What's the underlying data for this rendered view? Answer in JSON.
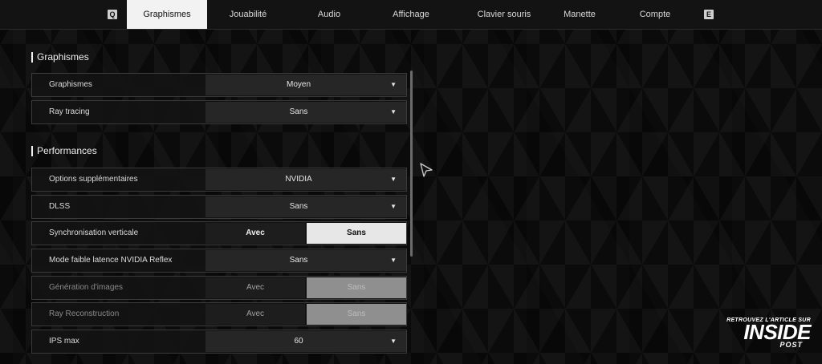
{
  "tabs": {
    "prev_key": "Q",
    "next_key": "E",
    "items": [
      {
        "label": "Graphismes",
        "active": true
      },
      {
        "label": "Jouabilité"
      },
      {
        "label": "Audio"
      },
      {
        "label": "Affichage"
      },
      {
        "label": "Clavier souris"
      },
      {
        "label": "Manette"
      },
      {
        "label": "Compte"
      }
    ]
  },
  "sections": {
    "graphismes": {
      "title": "Graphismes",
      "rows": [
        {
          "label": "Graphismes",
          "type": "select",
          "value": "Moyen"
        },
        {
          "label": "Ray tracing",
          "type": "select",
          "value": "Sans"
        }
      ]
    },
    "performances": {
      "title": "Performances",
      "rows": [
        {
          "label": "Options supplémentaires",
          "type": "select",
          "value": "NVIDIA"
        },
        {
          "label": "DLSS",
          "type": "select",
          "value": "Sans"
        },
        {
          "label": "Synchronisation verticale",
          "type": "toggle",
          "option_a": "Avec",
          "option_b": "Sans",
          "selected": "Sans"
        },
        {
          "label": "Mode faible latence NVIDIA Reflex",
          "type": "select",
          "value": "Sans"
        },
        {
          "label": "Génération d'images",
          "type": "toggle",
          "option_a": "Avec",
          "option_b": "Sans",
          "selected": "Sans",
          "disabled": true
        },
        {
          "label": "Ray Reconstruction",
          "type": "toggle",
          "option_a": "Avec",
          "option_b": "Sans",
          "selected": "Sans",
          "disabled": true
        },
        {
          "label": "IPS max",
          "type": "select",
          "value": "60"
        }
      ]
    }
  },
  "caret_glyph": "▼",
  "watermark": {
    "line1": "RETROUVEZ L'ARTICLE SUR",
    "brand": "INSIDE",
    "line3": "POST"
  }
}
